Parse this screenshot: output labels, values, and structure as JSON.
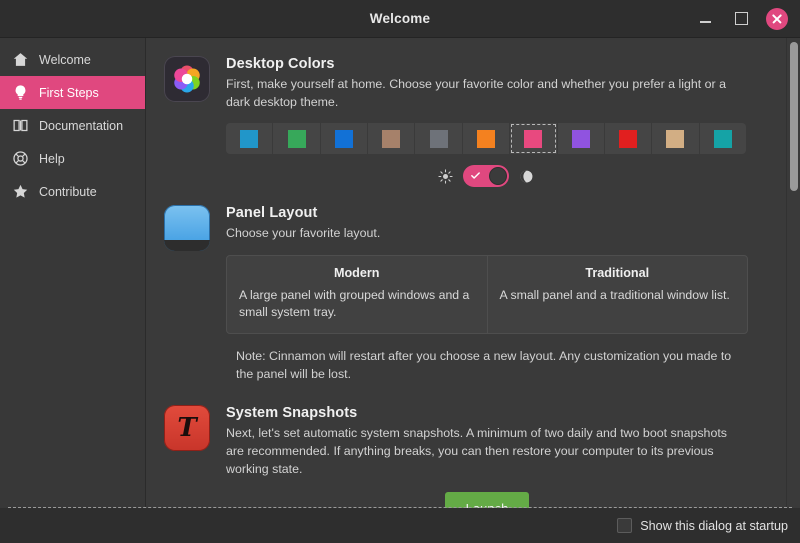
{
  "window": {
    "title": "Welcome",
    "minimize_label": "Minimize",
    "maximize_label": "Maximize",
    "close_label": "Close"
  },
  "sidebar": {
    "items": [
      {
        "label": "Welcome",
        "icon": "home-icon",
        "active": false
      },
      {
        "label": "First Steps",
        "icon": "lightbulb-icon",
        "active": true
      },
      {
        "label": "Documentation",
        "icon": "book-icon",
        "active": false
      },
      {
        "label": "Help",
        "icon": "lifebuoy-icon",
        "active": false
      },
      {
        "label": "Contribute",
        "icon": "star-icon",
        "active": false
      }
    ]
  },
  "sections": {
    "desktop_colors": {
      "title": "Desktop Colors",
      "description": "First, make yourself at home. Choose your favorite color and whether you prefer a light or a dark desktop theme.",
      "icon": "desktop-colors-icon",
      "swatches": [
        {
          "name": "aqua",
          "color": "#2196c9"
        },
        {
          "name": "green",
          "color": "#37a85a"
        },
        {
          "name": "blue",
          "color": "#1271d6"
        },
        {
          "name": "brown",
          "color": "#a6816a"
        },
        {
          "name": "grey",
          "color": "#6e7279"
        },
        {
          "name": "orange",
          "color": "#f4811f"
        },
        {
          "name": "pink",
          "color": "#e8497f"
        },
        {
          "name": "purple",
          "color": "#9053e0"
        },
        {
          "name": "red",
          "color": "#e11f1f"
        },
        {
          "name": "sand",
          "color": "#d2ae84"
        },
        {
          "name": "teal",
          "color": "#15a3a6"
        }
      ],
      "selected_swatch_index": 6,
      "theme_toggle": {
        "state": "on",
        "light_icon": "sun-icon",
        "dark_icon": "moon-icon",
        "accent": "#e0487f"
      }
    },
    "panel_layout": {
      "title": "Panel Layout",
      "description": "Choose your favorite layout.",
      "icon": "panel-layout-icon",
      "options": [
        {
          "title": "Modern",
          "description": "A large panel with grouped windows and a small system tray."
        },
        {
          "title": "Traditional",
          "description": "A small panel and a traditional window list."
        }
      ],
      "note": "Note: Cinnamon will restart after you choose a new layout. Any customization you made to the panel will be lost."
    },
    "system_snapshots": {
      "title": "System Snapshots",
      "description": "Next, let's set automatic system snapshots. A minimum of two daily and two boot snapshots are recommended. If anything breaks, you can then restore your computer to its previous working state.",
      "icon": "timeshift-icon",
      "icon_glyph": "T",
      "launch_label": "Launch",
      "launch_color": "#64ab46"
    }
  },
  "footer": {
    "startup_checkbox_label": "Show this dialog at startup",
    "startup_checkbox_checked": false
  }
}
